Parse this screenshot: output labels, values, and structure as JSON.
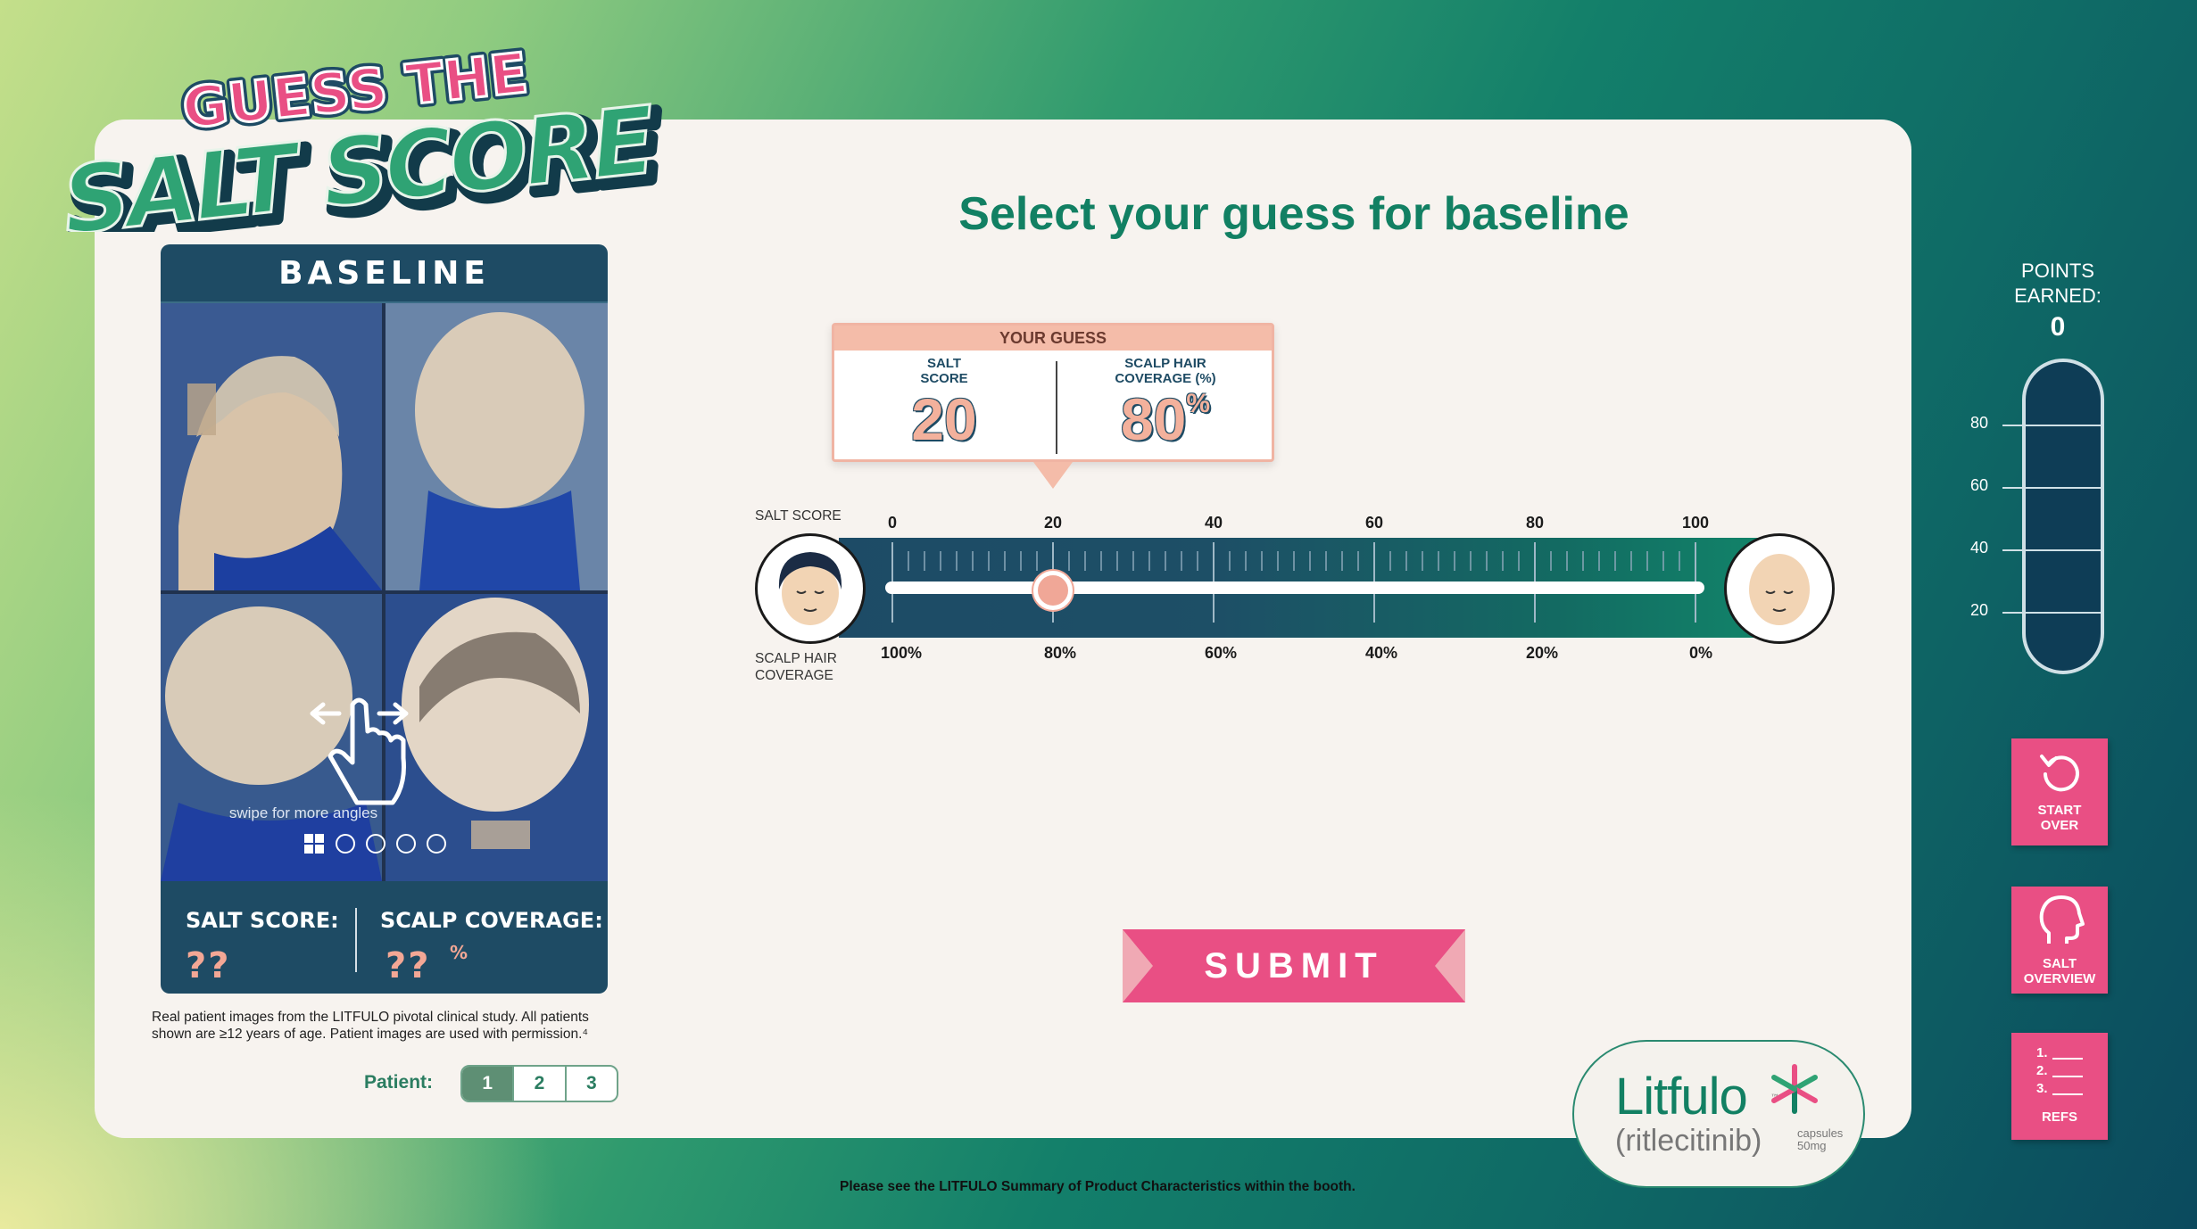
{
  "logo": {
    "line1": "GUESS THE",
    "line2": "SALT SCORE"
  },
  "panel": {
    "title": "BASELINE",
    "swipe_hint": "swipe for more angles",
    "salt_label": "SALT SCORE:",
    "salt_value": "??",
    "coverage_label": "SCALP COVERAGE:",
    "coverage_value": "??",
    "coverage_unit": "%"
  },
  "disclaimer": "Real patient images from the LITFULO pivotal clinical study. All patients shown are ≥12 years of age. Patient images are used with permission.⁴",
  "patient": {
    "label": "Patient:",
    "tabs": [
      "1",
      "2",
      "3"
    ],
    "active": "1"
  },
  "heading": "Select your guess for baseline",
  "guess": {
    "header": "YOUR GUESS",
    "salt_label_1": "SALT",
    "salt_label_2": "SCORE",
    "salt_value": "20",
    "coverage_label_1": "SCALP HAIR",
    "coverage_label_2": "COVERAGE (%)",
    "coverage_value": "80",
    "coverage_unit": "%"
  },
  "slider": {
    "top_label": "SALT SCORE",
    "bottom_label_1": "SCALP HAIR",
    "bottom_label_2": "COVERAGE",
    "salt_ticks": [
      "0",
      "20",
      "40",
      "60",
      "80",
      "100"
    ],
    "coverage_ticks": [
      "100%",
      "80%",
      "60%",
      "40%",
      "20%",
      "0%"
    ],
    "value": 20,
    "min": 0,
    "max": 100
  },
  "submit_label": "SUBMIT",
  "brand": {
    "name": "Litfulo",
    "tm": "™",
    "generic": "(ritlecitinib)",
    "form_1": "capsules",
    "form_2": "50mg"
  },
  "smpc_note": "Please see the LITFULO Summary of Product Characteristics within the booth.",
  "points": {
    "label_1": "POINTS",
    "label_2": "EARNED:",
    "value": "0",
    "meter_ticks": [
      "80",
      "60",
      "40",
      "20"
    ],
    "fill_fraction": 0
  },
  "side_buttons": {
    "start_over_1": "START",
    "start_over_2": "OVER",
    "salt_overview_1": "SALT",
    "salt_overview_2": "OVERVIEW",
    "refs_1": "1.",
    "refs_2": "2.",
    "refs_3": "3.",
    "refs_label": "REFS"
  },
  "colors": {
    "accent_pink": "#e94f84",
    "brand_green": "#128063",
    "navy": "#1e4b64",
    "salmon": "#f3b19c"
  }
}
